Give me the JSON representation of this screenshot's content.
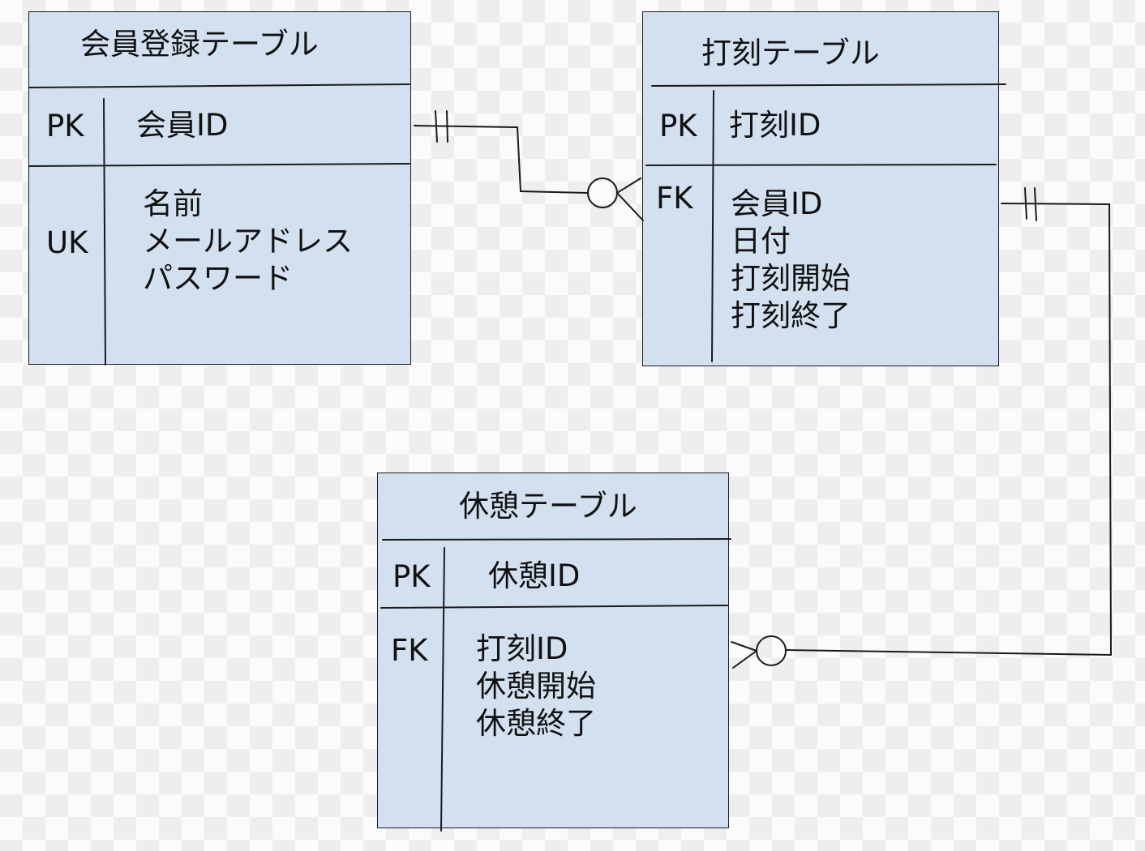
{
  "tables": {
    "member": {
      "title": "会員登録テーブル",
      "pk_label": "PK",
      "pk_field": "会員ID",
      "uk_label": "UK",
      "uk_fields": [
        "名前",
        "メールアドレス",
        "パスワード"
      ]
    },
    "punch": {
      "title": "打刻テーブル",
      "pk_label": "PK",
      "pk_field": "打刻ID",
      "fk_label": "FK",
      "fk_fields": [
        "会員ID",
        "日付",
        "打刻開始",
        "打刻終了"
      ]
    },
    "break": {
      "title": "休憩テーブル",
      "pk_label": "PK",
      "pk_field": "休憩ID",
      "fk_label": "FK",
      "fk_fields": [
        "打刻ID",
        "休憩開始",
        "休憩終了"
      ]
    }
  },
  "relationships": [
    {
      "from": "会員登録テーブル",
      "from_cardinality": "one-and-only-one",
      "to": "打刻テーブル",
      "to_cardinality": "zero-or-many"
    },
    {
      "from": "打刻テーブル",
      "from_cardinality": "one-and-only-one",
      "to": "休憩テーブル",
      "to_cardinality": "zero-or-many"
    }
  ],
  "colors": {
    "entity_fill": "#d3e0ef",
    "line": "#1a1a1a",
    "background_checker": "#eeeeee"
  }
}
